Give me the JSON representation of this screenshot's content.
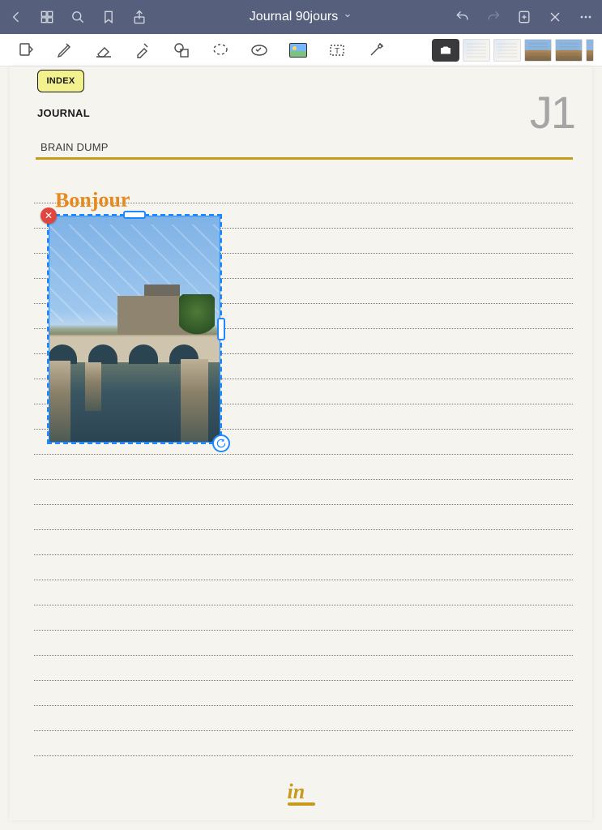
{
  "topbar": {
    "title": "Journal 90jours"
  },
  "toolbar": {
    "tools": [
      "readonly",
      "pen",
      "eraser",
      "highlighter",
      "shape",
      "lasso",
      "stamp",
      "image",
      "text",
      "laser"
    ]
  },
  "page": {
    "index_label": "INDEX",
    "section": "JOURNAL",
    "page_code": "J1",
    "subheading": "BRAIN DUMP",
    "handwriting": "Bonjour",
    "footer_mark": "in"
  },
  "selection": {
    "type": "image",
    "description": "photo-paris-bridge",
    "selected": true
  }
}
